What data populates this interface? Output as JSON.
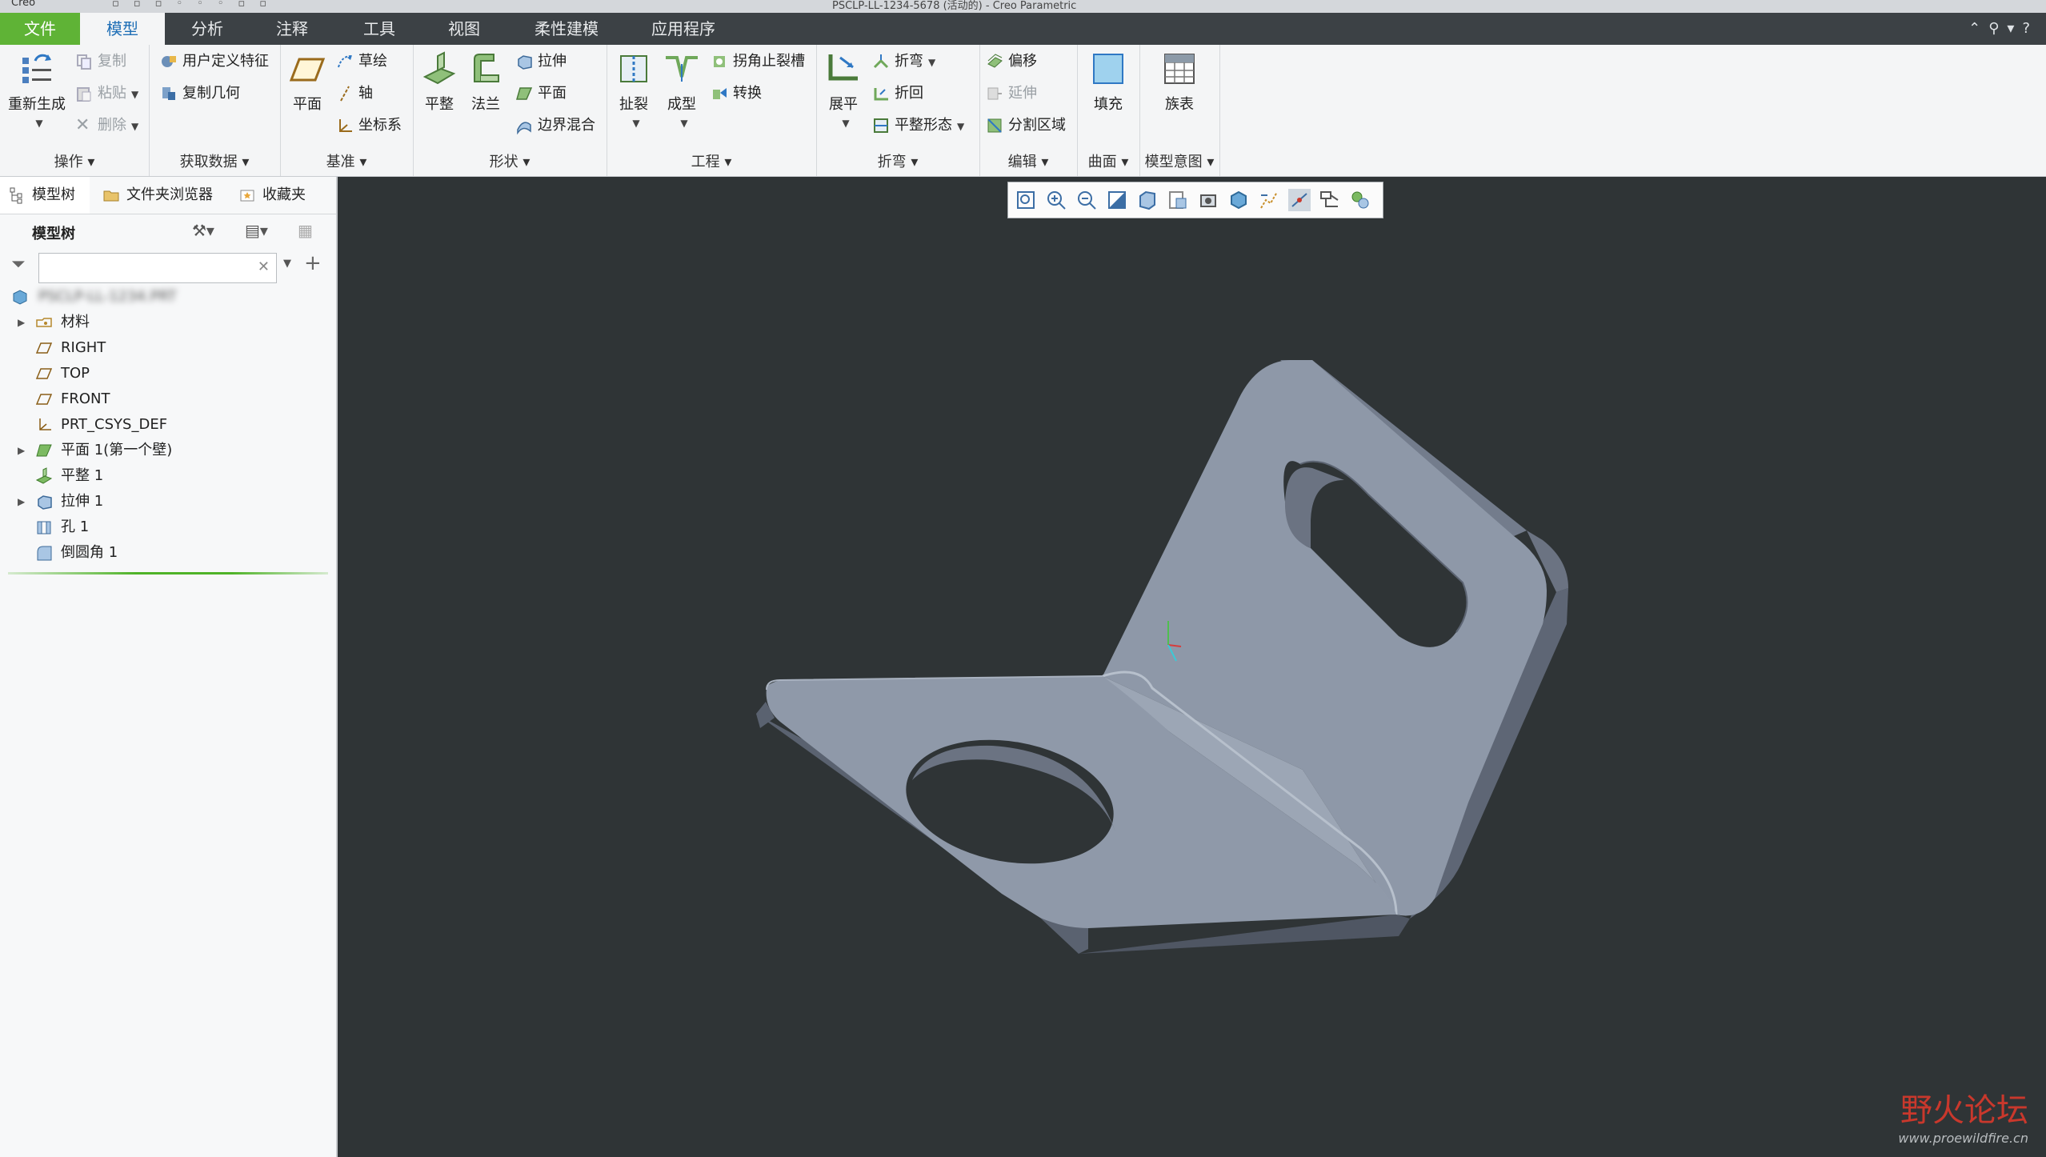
{
  "titlebar": {
    "app_name": "Creo",
    "window_title": "PSCLP-LL-1234-5678 (活动的) - Creo Parametric"
  },
  "tabs": [
    {
      "label": "文件"
    },
    {
      "label": "模型"
    },
    {
      "label": "分析"
    },
    {
      "label": "注释"
    },
    {
      "label": "工具"
    },
    {
      "label": "视图"
    },
    {
      "label": "柔性建模"
    },
    {
      "label": "应用程序"
    }
  ],
  "ribbon": {
    "operations": {
      "regenerate": "重新生成",
      "copy": "复制",
      "paste": "粘贴",
      "delete": "删除",
      "group": "操作"
    },
    "get_data": {
      "udf": "用户定义特征",
      "copy_geom": "复制几何",
      "group": "获取数据"
    },
    "datum": {
      "plane": "平面",
      "sketch": "草绘",
      "axis": "轴",
      "csys": "坐标系",
      "group": "基准"
    },
    "shapes": {
      "flat": "平整",
      "flange": "法兰",
      "extrude": "拉伸",
      "planar": "平面",
      "blend": "边界混合",
      "group": "形状"
    },
    "engineering": {
      "rip": "扯裂",
      "form": "成型",
      "corner_relief": "拐角止裂槽",
      "convert": "转换",
      "group": "工程"
    },
    "bends": {
      "unbend": "展平",
      "bend": "折弯",
      "bend_back": "折回",
      "flat_state": "平整形态",
      "group": "折弯"
    },
    "editing": {
      "offset": "偏移",
      "extend": "延伸",
      "split": "分割区域",
      "group": "编辑"
    },
    "surfaces": {
      "fill": "填充",
      "group": "曲面"
    },
    "model_intent": {
      "family_table": "族表",
      "group": "模型意图"
    }
  },
  "left_panel": {
    "tabs": {
      "model_tree": "模型树",
      "folder_browser": "文件夹浏览器",
      "favorites": "收藏夹"
    },
    "tree_header": "模型树",
    "search_placeholder": "",
    "tree_items": [
      {
        "label": "PSCLP-LL-1234.PRT"
      },
      {
        "label": "材料"
      },
      {
        "label": "RIGHT"
      },
      {
        "label": "TOP"
      },
      {
        "label": "FRONT"
      },
      {
        "label": "PRT_CSYS_DEF"
      },
      {
        "label": "平面 1(第一个壁)"
      },
      {
        "label": "平整 1"
      },
      {
        "label": "拉伸 1"
      },
      {
        "label": "孔 1"
      },
      {
        "label": "倒圆角 1"
      }
    ]
  },
  "watermark": {
    "cn": "野火论坛",
    "url": "www.proewildfire.cn"
  },
  "colors": {
    "file_tab": "#5fb336",
    "background": "#2f3436",
    "part": "#8e98a8",
    "accent": "#1f6fb6"
  }
}
